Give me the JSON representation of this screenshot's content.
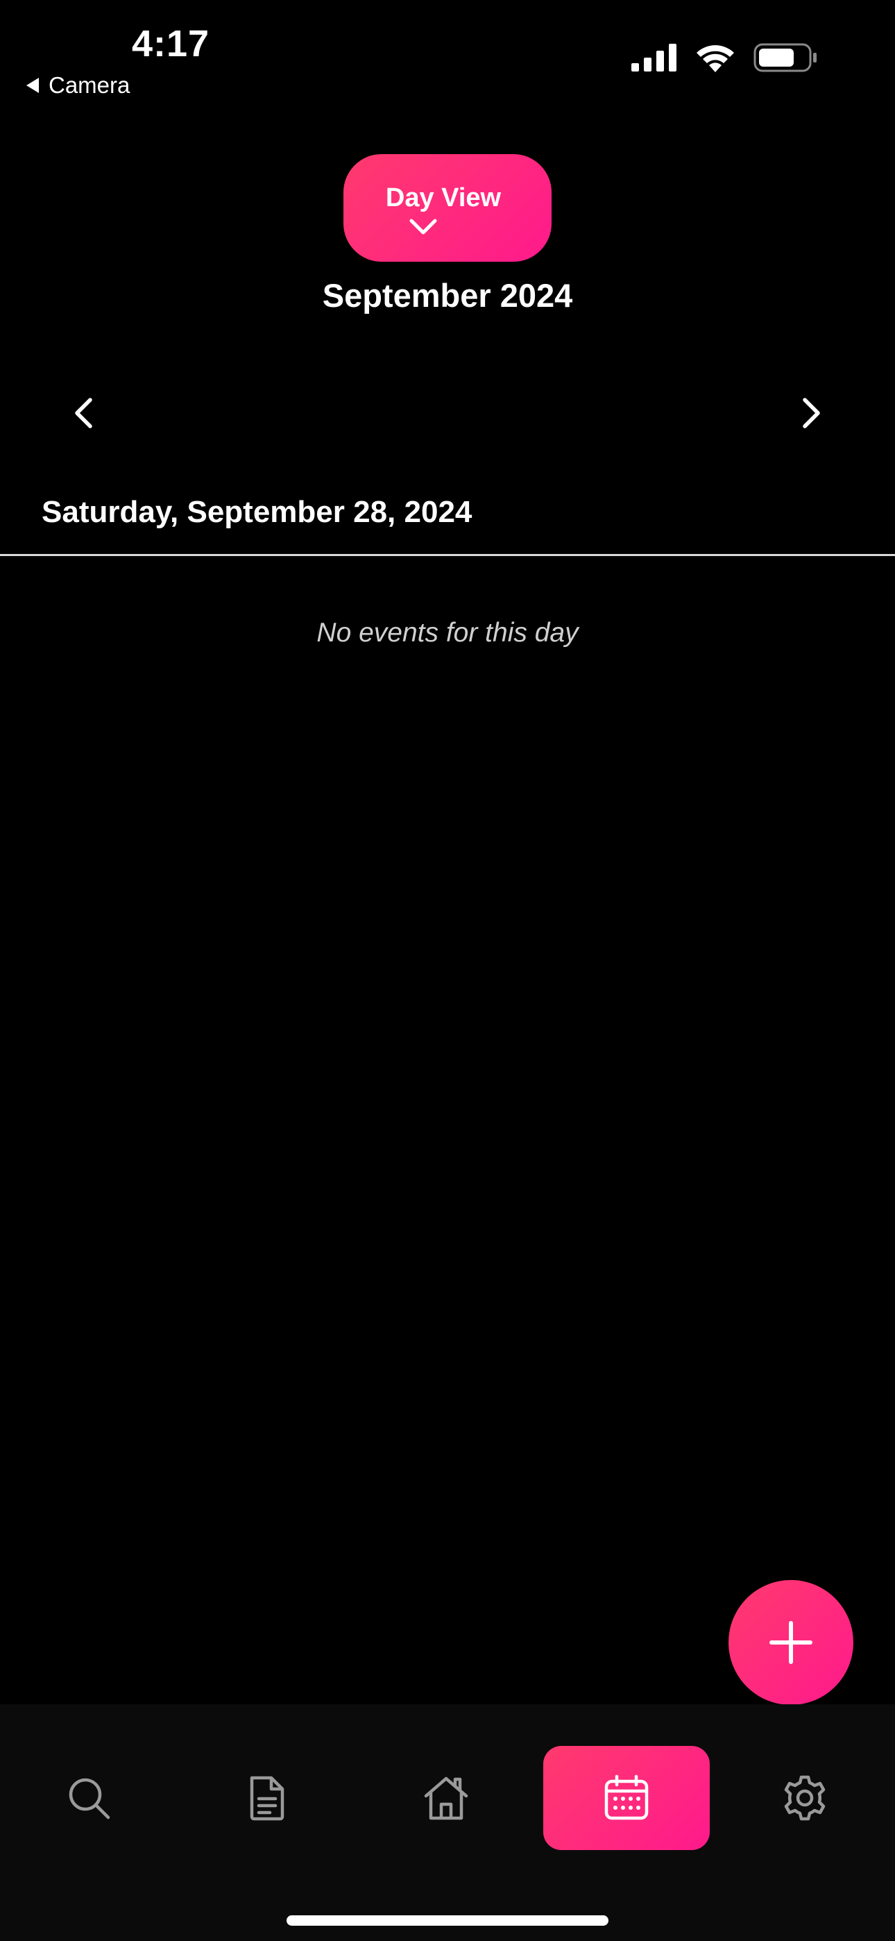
{
  "status_bar": {
    "time": "4:17",
    "back_app": "Camera"
  },
  "header": {
    "view_toggle_label": "Day View",
    "month_title": "September 2024"
  },
  "day": {
    "heading": "Saturday, September 28, 2024",
    "empty_message": "No events for this day"
  },
  "tabbar": {
    "tabs": [
      {
        "icon": "search-icon",
        "active": false
      },
      {
        "icon": "document-icon",
        "active": false
      },
      {
        "icon": "home-icon",
        "active": false
      },
      {
        "icon": "calendar-icon",
        "active": true
      },
      {
        "icon": "gear-icon",
        "active": false
      }
    ]
  },
  "colors": {
    "accent_start": "#ff3a6e",
    "accent_end": "#ff1a8c",
    "background": "#000000",
    "tabbar_bg": "#0b0b0b"
  }
}
